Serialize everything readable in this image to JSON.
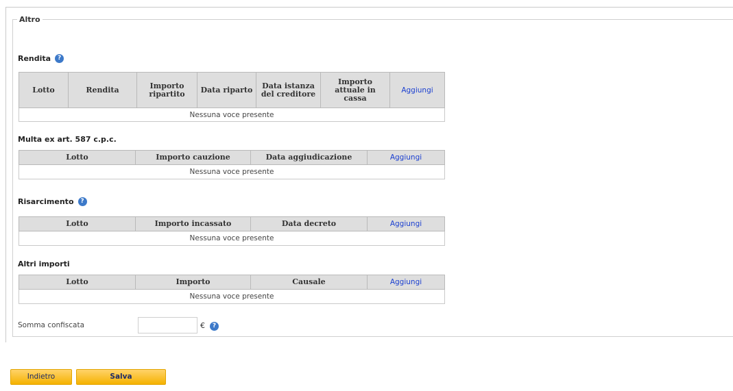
{
  "fieldset_legend": "Altro",
  "rendita": {
    "title": "Rendita",
    "headers": [
      "Lotto",
      "Rendita",
      "Importo ripartito",
      "Data riparto",
      "Data istanza del creditore",
      "Importo attuale in cassa"
    ],
    "add_label": "Aggiungi",
    "empty_text": "Nessuna voce presente"
  },
  "multa": {
    "title": "Multa ex art. 587 c.p.c.",
    "headers": [
      "Lotto",
      "Importo cauzione",
      "Data aggiudicazione"
    ],
    "add_label": "Aggiungi",
    "empty_text": "Nessuna voce presente"
  },
  "risarcimento": {
    "title": "Risarcimento",
    "headers": [
      "Lotto",
      "Importo incassato",
      "Data decreto"
    ],
    "add_label": "Aggiungi",
    "empty_text": "Nessuna voce presente"
  },
  "altri_importi": {
    "title": "Altri importi",
    "headers": [
      "Lotto",
      "Importo",
      "Causale"
    ],
    "add_label": "Aggiungi",
    "empty_text": "Nessuna voce presente"
  },
  "somma_confiscata": {
    "label": "Somma confiscata",
    "value": "",
    "currency": "€"
  },
  "help_icon_glyph": "?",
  "buttons": {
    "back_label": "Indietro",
    "save_label": "Salva"
  },
  "colors": {
    "button_bg": "#f5b200",
    "link": "#1a3fd0",
    "help_icon": "#3c79c9",
    "header_bg": "#dedede"
  }
}
